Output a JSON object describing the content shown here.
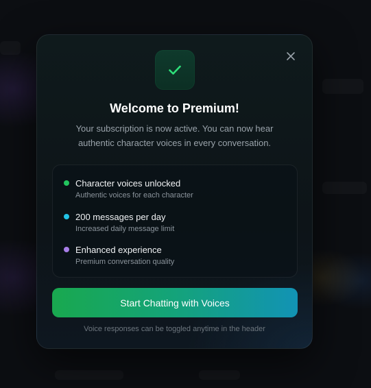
{
  "modal": {
    "title": "Welcome to Premium!",
    "subtitle": "Your subscription is now active. You can now hear authentic character voices in every conversation.",
    "close_icon": "close-icon",
    "badge_icon": "checkmark-icon",
    "features": [
      {
        "title": "Character voices unlocked",
        "description": "Authentic voices for each character",
        "dot_color": "#22c55e"
      },
      {
        "title": "200 messages per day",
        "description": "Increased daily message limit",
        "dot_color": "#22c3e6"
      },
      {
        "title": "Enhanced experience",
        "description": "Premium conversation quality",
        "dot_color": "#a87ee8"
      }
    ],
    "cta_label": "Start Chatting with Voices",
    "footnote": "Voice responses can be toggled anytime in the header"
  },
  "colors": {
    "accent_green": "#22c55e",
    "accent_cyan": "#1293b5",
    "check_green": "#2ee07a"
  }
}
